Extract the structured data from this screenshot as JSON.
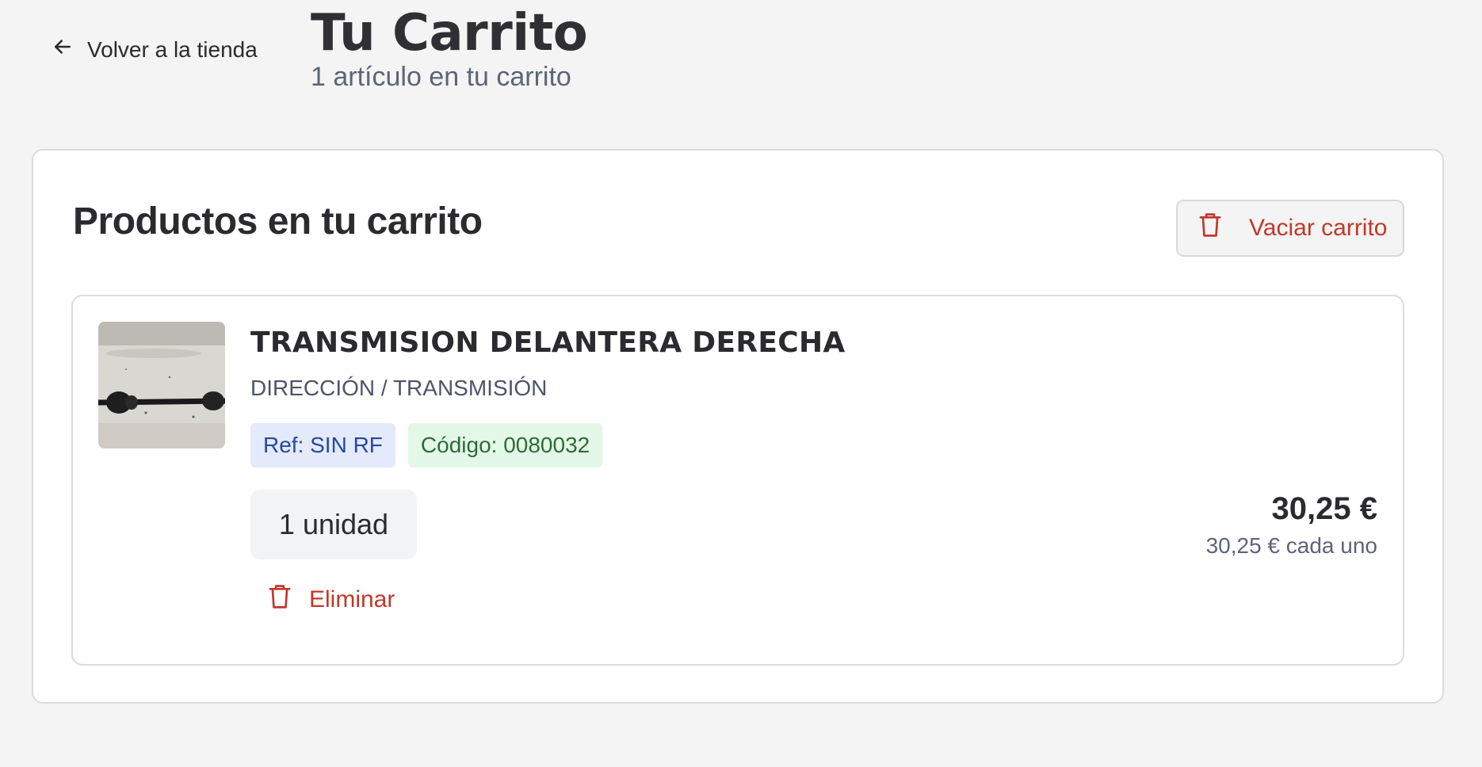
{
  "header": {
    "back_label": "Volver a la tienda",
    "title": "Tu Carrito",
    "subtitle": "1 artículo en tu carrito"
  },
  "cart": {
    "panel_title": "Productos en tu carrito",
    "empty_cart_label": "Vaciar carrito",
    "items": [
      {
        "name": "TRANSMISION DELANTERA DERECHA",
        "category": "DIRECCIÓN / TRANSMISIÓN",
        "ref_label": "Ref: SIN RF",
        "code_label": "Código: 0080032",
        "quantity_label": "1 unidad",
        "total_price": "30,25 €",
        "unit_price": "30,25 € cada uno",
        "remove_label": "Eliminar"
      }
    ]
  },
  "icons": {
    "back": "arrow-left-icon",
    "empty_cart": "trash-icon",
    "remove": "trash-icon"
  },
  "colors": {
    "background": "#f4f4f4",
    "danger": "#c0392b",
    "ref_badge_bg": "#e2eafc",
    "ref_badge_text": "#2848a0",
    "code_badge_bg": "#e3f8e6",
    "code_badge_text": "#2e6b3a"
  }
}
